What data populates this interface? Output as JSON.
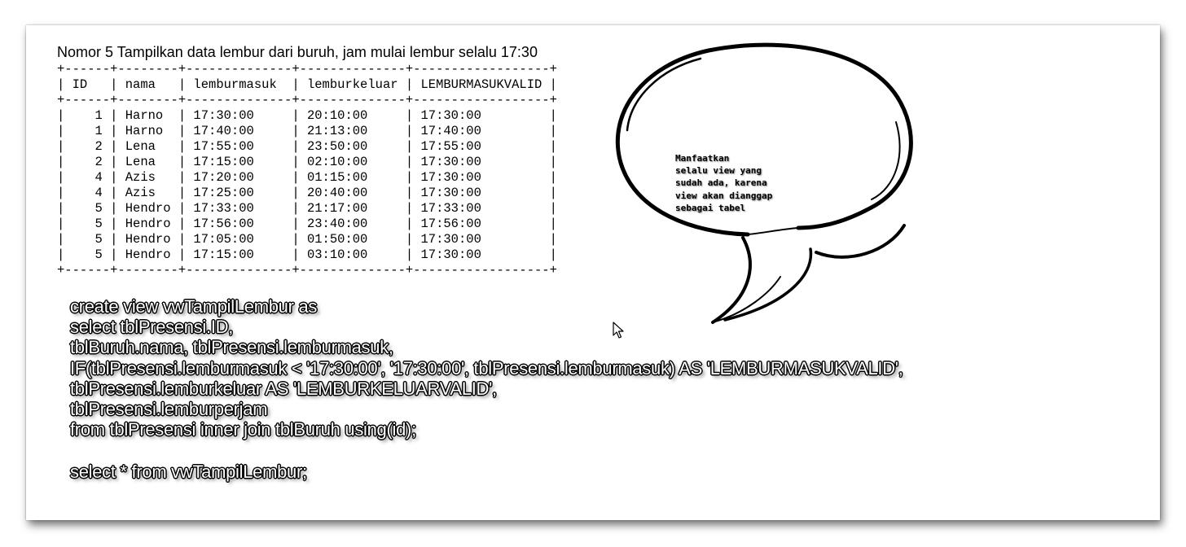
{
  "heading": "Nomor 5 Tampilkan data lembur dari buruh, jam mulai lembur selalu 17:30",
  "result_table": {
    "border": "+------+--------+--------------+--------------+------------------+",
    "header": "| ID   | nama   | lemburmasuk  | lemburkeluar | LEMBURMASUKVALID |",
    "rows": [
      "|    1 | Harno  | 17:30:00     | 20:10:00     | 17:30:00         |",
      "|    1 | Harno  | 17:40:00     | 21:13:00     | 17:40:00         |",
      "|    2 | Lena   | 17:55:00     | 23:50:00     | 17:55:00         |",
      "|    2 | Lena   | 17:15:00     | 02:10:00     | 17:30:00         |",
      "|    4 | Azis   | 17:20:00     | 01:15:00     | 17:30:00         |",
      "|    4 | Azis   | 17:25:00     | 20:40:00     | 17:30:00         |",
      "|    5 | Hendro | 17:33:00     | 21:17:00     | 17:33:00         |",
      "|    5 | Hendro | 17:56:00     | 23:40:00     | 17:56:00         |",
      "|    5 | Hendro | 17:05:00     | 01:50:00     | 17:30:00         |",
      "|    5 | Hendro | 17:15:00     | 03:10:00     | 17:30:00         |"
    ]
  },
  "callout": {
    "lines": [
      "Manfaatkan",
      "selalu view yang",
      "sudah ada, karena",
      "view akan dianggap",
      "sebagai tabel"
    ]
  },
  "sql": {
    "create_view": [
      "create view vwTampilLembur as",
      "select tblPresensi.ID,",
      "tblBuruh.nama, tblPresensi.lemburmasuk,",
      "IF(tblPresensi.lemburmasuk < '17:30:00', '17:30:00', tblPresensi.lemburmasuk) AS 'LEMBURMASUKVALID',",
      "tblPresensi.lemburkeluar AS 'LEMBURKELUARVALID',",
      "tblPresensi.lemburperjam",
      "from tblPresensi inner join tblBuruh using(id);"
    ],
    "select_view": "select * from vwTampilLembur;"
  },
  "colors": {
    "background": "#ffffff",
    "text": "#000000",
    "code_fill": "#ffffff",
    "code_outline": "#000000"
  },
  "icons": {
    "pointer": "mouse-pointer-icon",
    "callout": "speech-bubble-icon"
  }
}
